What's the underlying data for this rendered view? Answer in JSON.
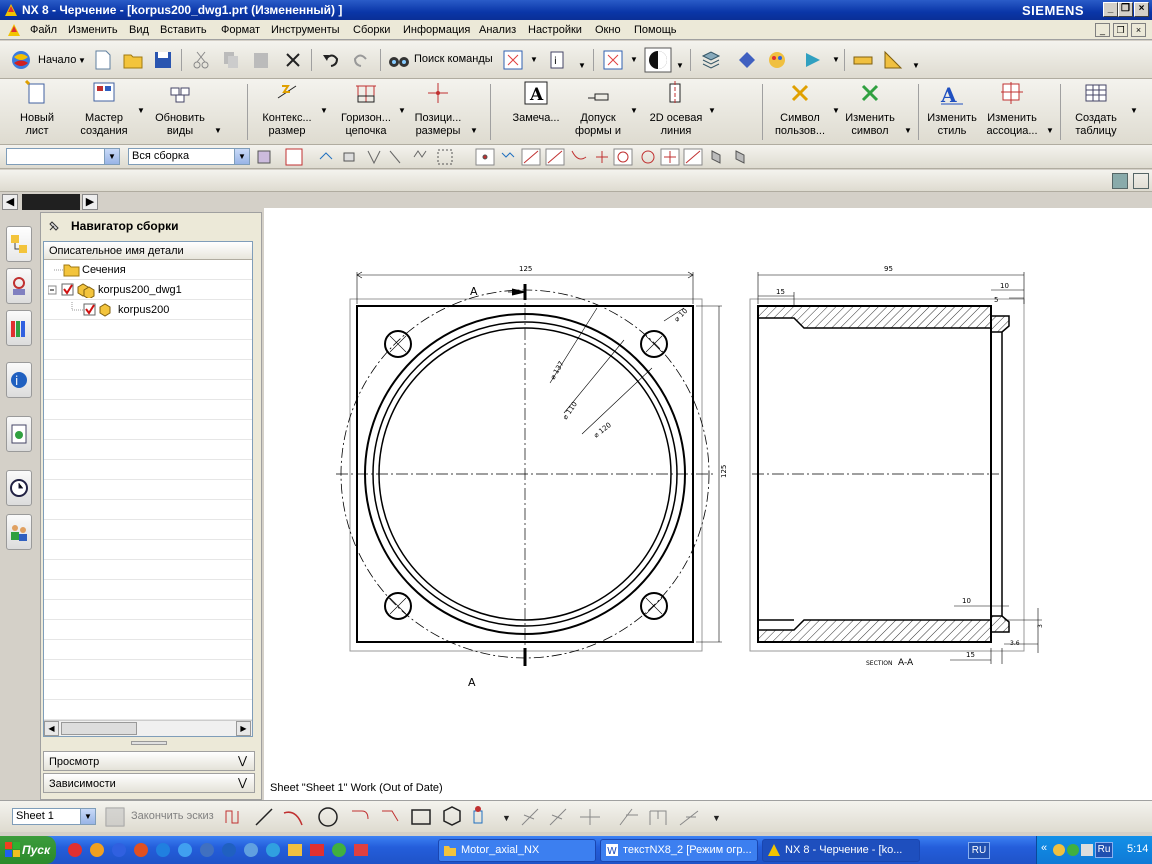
{
  "window": {
    "title": "NX 8 - Черчение - [korpus200_dwg1.prt (Измененный) ]",
    "brand": "SIEMENS"
  },
  "menu": [
    "Файл",
    "Изменить",
    "Вид",
    "Вставить",
    "Формат",
    "Инструменты",
    "Сборки",
    "Информация",
    "Анализ",
    "Настройки",
    "Окно",
    "Помощь"
  ],
  "standard_toolbar": {
    "start_label": "Начало",
    "command_finder_label": "Поиск команды"
  },
  "drafting_tools": [
    {
      "line1": "Новый",
      "line2": "лист"
    },
    {
      "line1": "Мастер",
      "line2": "создания"
    },
    {
      "line1": "Обновить",
      "line2": "виды"
    },
    {
      "line1": "Контекс...",
      "line2": "размер"
    },
    {
      "line1": "Горизон...",
      "line2": "цепочка"
    },
    {
      "line1": "Позици...",
      "line2": "размеры"
    },
    {
      "line1": "Замеча...",
      "line2": ""
    },
    {
      "line1": "Допуск",
      "line2": "формы и"
    },
    {
      "line1": "2D осевая",
      "line2": "линия"
    },
    {
      "line1": "Символ",
      "line2": "пользов..."
    },
    {
      "line1": "Изменить",
      "line2": "символ"
    },
    {
      "line1": "Изменить",
      "line2": "стиль"
    },
    {
      "line1": "Изменить",
      "line2": "ассоциа..."
    },
    {
      "line1": "Создать",
      "line2": "таблицу"
    }
  ],
  "selection_bar": {
    "filter_value": "",
    "scope_value": "Вся сборка"
  },
  "navigator": {
    "title": "Навигатор сборки",
    "column_header": "Описательное имя детали",
    "items": [
      {
        "label": "Сечения"
      },
      {
        "label": "korpus200_dwg1"
      },
      {
        "label": "korpus200"
      }
    ],
    "panels": [
      "Просмотр",
      "Зависимости"
    ]
  },
  "drawing": {
    "status": "Sheet \"Sheet 1\" Work (Out of Date)",
    "section_label": "A",
    "section_view_caption_prefix": "SECTION",
    "section_view_caption": "A-A",
    "dims": {
      "front_width": "125",
      "front_height": "125",
      "hole_dia": "⌀ 10",
      "bolt_circle": "⌀ 137",
      "outer_ring": "⌀ 120",
      "inner_ring": "⌀ 110",
      "section_length": "95",
      "left_step": "15",
      "right_step": "10",
      "groove": "5",
      "bottom_10": "10",
      "bottom_15": "15",
      "bottom_36": "3.6",
      "bottom_side": "3"
    }
  },
  "sketch_bar": {
    "sheet_value": "Sheet 1",
    "finish_sketch_label": "Закончить эскиз"
  },
  "taskbar": {
    "start_label": "Пуск",
    "tasks": [
      {
        "label": "Motor_axial_NX"
      },
      {
        "label": "текстNX8_2 [Режим огр..."
      },
      {
        "label": "NX 8 - Черчение - [ko..."
      }
    ],
    "language": "RU",
    "tray_lang": "Ru",
    "clock": "5:14"
  },
  "colors": {
    "title_bar": "#0a36a8",
    "taskbar": "#245edb",
    "drawing_bg": "#ffffff"
  }
}
